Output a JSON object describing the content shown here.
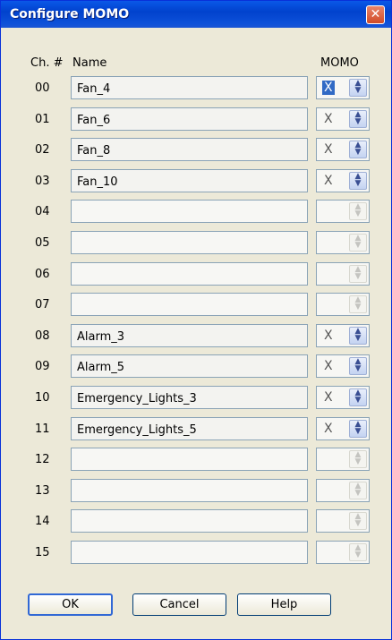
{
  "window": {
    "title": "Configure MOMO",
    "close_glyph": "✕"
  },
  "headers": {
    "channel": "Ch. #",
    "name": "Name",
    "momo": "MOMO"
  },
  "rows": [
    {
      "ch": "00",
      "name": "Fan_4",
      "momo": "X"
    },
    {
      "ch": "01",
      "name": "Fan_6",
      "momo": "X"
    },
    {
      "ch": "02",
      "name": "Fan_8",
      "momo": "X"
    },
    {
      "ch": "03",
      "name": "Fan_10",
      "momo": "X"
    },
    {
      "ch": "04",
      "name": "",
      "momo": ""
    },
    {
      "ch": "05",
      "name": "",
      "momo": ""
    },
    {
      "ch": "06",
      "name": "",
      "momo": ""
    },
    {
      "ch": "07",
      "name": "",
      "momo": ""
    },
    {
      "ch": "08",
      "name": "Alarm_3",
      "momo": "X"
    },
    {
      "ch": "09",
      "name": "Alarm_5",
      "momo": "X"
    },
    {
      "ch": "10",
      "name": "Emergency_Lights_3",
      "momo": "X"
    },
    {
      "ch": "11",
      "name": "Emergency_Lights_5",
      "momo": "X"
    },
    {
      "ch": "12",
      "name": "",
      "momo": ""
    },
    {
      "ch": "13",
      "name": "",
      "momo": ""
    },
    {
      "ch": "14",
      "name": "",
      "momo": ""
    },
    {
      "ch": "15",
      "name": "",
      "momo": ""
    }
  ],
  "buttons": {
    "ok": "OK",
    "cancel": "Cancel",
    "help": "Help"
  }
}
